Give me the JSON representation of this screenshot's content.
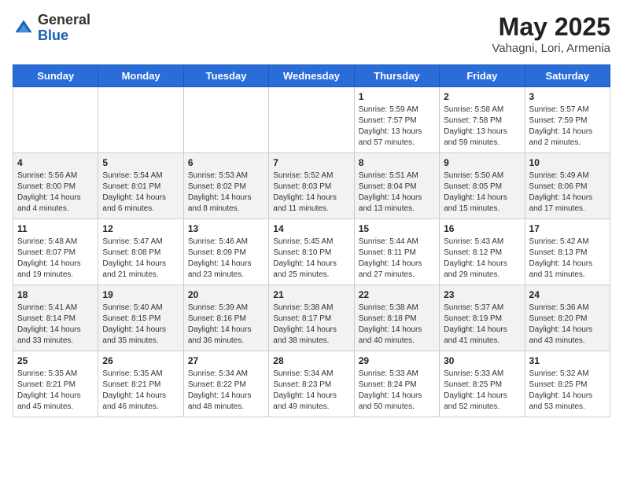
{
  "header": {
    "logo_general": "General",
    "logo_blue": "Blue",
    "month_title": "May 2025",
    "location": "Vahagni, Lori, Armenia"
  },
  "days_of_week": [
    "Sunday",
    "Monday",
    "Tuesday",
    "Wednesday",
    "Thursday",
    "Friday",
    "Saturday"
  ],
  "weeks": [
    [
      {
        "day": "",
        "info": ""
      },
      {
        "day": "",
        "info": ""
      },
      {
        "day": "",
        "info": ""
      },
      {
        "day": "",
        "info": ""
      },
      {
        "day": "1",
        "info": "Sunrise: 5:59 AM\nSunset: 7:57 PM\nDaylight: 13 hours\nand 57 minutes."
      },
      {
        "day": "2",
        "info": "Sunrise: 5:58 AM\nSunset: 7:58 PM\nDaylight: 13 hours\nand 59 minutes."
      },
      {
        "day": "3",
        "info": "Sunrise: 5:57 AM\nSunset: 7:59 PM\nDaylight: 14 hours\nand 2 minutes."
      }
    ],
    [
      {
        "day": "4",
        "info": "Sunrise: 5:56 AM\nSunset: 8:00 PM\nDaylight: 14 hours\nand 4 minutes."
      },
      {
        "day": "5",
        "info": "Sunrise: 5:54 AM\nSunset: 8:01 PM\nDaylight: 14 hours\nand 6 minutes."
      },
      {
        "day": "6",
        "info": "Sunrise: 5:53 AM\nSunset: 8:02 PM\nDaylight: 14 hours\nand 8 minutes."
      },
      {
        "day": "7",
        "info": "Sunrise: 5:52 AM\nSunset: 8:03 PM\nDaylight: 14 hours\nand 11 minutes."
      },
      {
        "day": "8",
        "info": "Sunrise: 5:51 AM\nSunset: 8:04 PM\nDaylight: 14 hours\nand 13 minutes."
      },
      {
        "day": "9",
        "info": "Sunrise: 5:50 AM\nSunset: 8:05 PM\nDaylight: 14 hours\nand 15 minutes."
      },
      {
        "day": "10",
        "info": "Sunrise: 5:49 AM\nSunset: 8:06 PM\nDaylight: 14 hours\nand 17 minutes."
      }
    ],
    [
      {
        "day": "11",
        "info": "Sunrise: 5:48 AM\nSunset: 8:07 PM\nDaylight: 14 hours\nand 19 minutes."
      },
      {
        "day": "12",
        "info": "Sunrise: 5:47 AM\nSunset: 8:08 PM\nDaylight: 14 hours\nand 21 minutes."
      },
      {
        "day": "13",
        "info": "Sunrise: 5:46 AM\nSunset: 8:09 PM\nDaylight: 14 hours\nand 23 minutes."
      },
      {
        "day": "14",
        "info": "Sunrise: 5:45 AM\nSunset: 8:10 PM\nDaylight: 14 hours\nand 25 minutes."
      },
      {
        "day": "15",
        "info": "Sunrise: 5:44 AM\nSunset: 8:11 PM\nDaylight: 14 hours\nand 27 minutes."
      },
      {
        "day": "16",
        "info": "Sunrise: 5:43 AM\nSunset: 8:12 PM\nDaylight: 14 hours\nand 29 minutes."
      },
      {
        "day": "17",
        "info": "Sunrise: 5:42 AM\nSunset: 8:13 PM\nDaylight: 14 hours\nand 31 minutes."
      }
    ],
    [
      {
        "day": "18",
        "info": "Sunrise: 5:41 AM\nSunset: 8:14 PM\nDaylight: 14 hours\nand 33 minutes."
      },
      {
        "day": "19",
        "info": "Sunrise: 5:40 AM\nSunset: 8:15 PM\nDaylight: 14 hours\nand 35 minutes."
      },
      {
        "day": "20",
        "info": "Sunrise: 5:39 AM\nSunset: 8:16 PM\nDaylight: 14 hours\nand 36 minutes."
      },
      {
        "day": "21",
        "info": "Sunrise: 5:38 AM\nSunset: 8:17 PM\nDaylight: 14 hours\nand 38 minutes."
      },
      {
        "day": "22",
        "info": "Sunrise: 5:38 AM\nSunset: 8:18 PM\nDaylight: 14 hours\nand 40 minutes."
      },
      {
        "day": "23",
        "info": "Sunrise: 5:37 AM\nSunset: 8:19 PM\nDaylight: 14 hours\nand 41 minutes."
      },
      {
        "day": "24",
        "info": "Sunrise: 5:36 AM\nSunset: 8:20 PM\nDaylight: 14 hours\nand 43 minutes."
      }
    ],
    [
      {
        "day": "25",
        "info": "Sunrise: 5:35 AM\nSunset: 8:21 PM\nDaylight: 14 hours\nand 45 minutes."
      },
      {
        "day": "26",
        "info": "Sunrise: 5:35 AM\nSunset: 8:21 PM\nDaylight: 14 hours\nand 46 minutes."
      },
      {
        "day": "27",
        "info": "Sunrise: 5:34 AM\nSunset: 8:22 PM\nDaylight: 14 hours\nand 48 minutes."
      },
      {
        "day": "28",
        "info": "Sunrise: 5:34 AM\nSunset: 8:23 PM\nDaylight: 14 hours\nand 49 minutes."
      },
      {
        "day": "29",
        "info": "Sunrise: 5:33 AM\nSunset: 8:24 PM\nDaylight: 14 hours\nand 50 minutes."
      },
      {
        "day": "30",
        "info": "Sunrise: 5:33 AM\nSunset: 8:25 PM\nDaylight: 14 hours\nand 52 minutes."
      },
      {
        "day": "31",
        "info": "Sunrise: 5:32 AM\nSunset: 8:25 PM\nDaylight: 14 hours\nand 53 minutes."
      }
    ]
  ]
}
